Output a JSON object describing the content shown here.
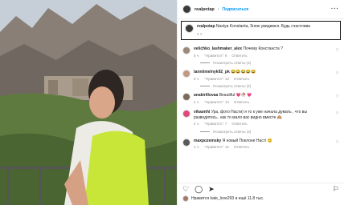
{
  "post": {
    "author": "realpotap",
    "follow": "Подписаться",
    "caption_author": "realpotap",
    "caption_text": "Nastya Konstanta, Зняю увидимся. Будь счастлива",
    "caption_time": "4 ч."
  },
  "comments": [
    {
      "user": "velichko_lashmaker_alex",
      "text": "Почему Констанста ?",
      "time": "5 ч.",
      "likes": "\"Нравится\": 9",
      "reply": "Ответить",
      "replies": "Посмотреть ответы (4)"
    },
    {
      "user": "tanniimelnyk92_pk",
      "text": "😂😂😂😂😂",
      "time": "5 ч.",
      "likes": "\"Нравится\": 13",
      "reply": "Ответить",
      "replies": "Посмотреть ответы (2)"
    },
    {
      "user": "anakirillovaa",
      "text": "Beautiful 💗🥀 💗",
      "time": "4 ч.",
      "likes": "\"Нравится\": 13",
      "reply": "Ответить",
      "replies": ""
    },
    {
      "user": "vikaonhi",
      "text": "Ура, фото Насти) я то к уже начала думать , что вы разводитесь.. как то мало вас видно вместе 🙈",
      "time": "4 ч.",
      "likes": "\"Нравится\": 7",
      "reply": "Ответить",
      "replies": "Посмотреть ответы (3)"
    },
    {
      "user": "maxpozemsky",
      "text": "Я новый Поклоне Насті 😊",
      "time": "4 ч.",
      "likes": "\"Нравится\": 12",
      "reply": "Ответить",
      "replies": ""
    }
  ],
  "footer": {
    "likes_text": "Нравится kate_love293 и ещё 11,8 тыс."
  },
  "icons": [
    "more-icon",
    "heart-icon",
    "comment-icon",
    "share-icon",
    "save-icon"
  ]
}
